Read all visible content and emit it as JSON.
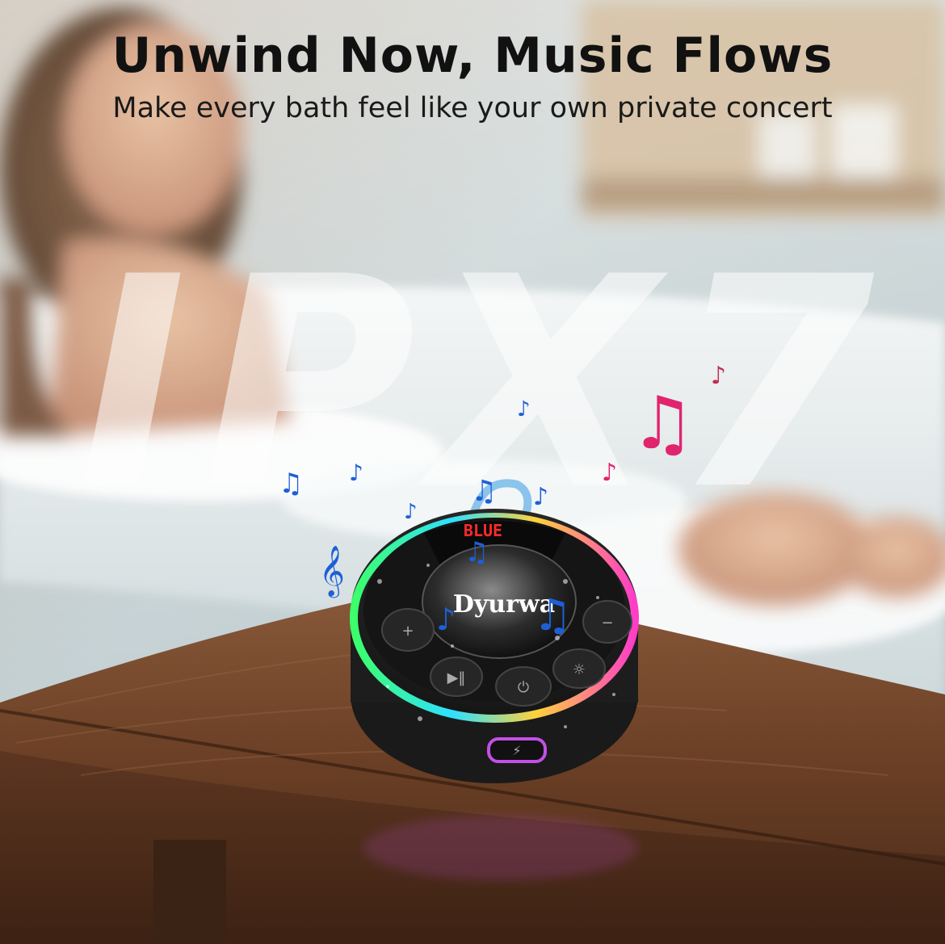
{
  "headline": "Unwind Now, Music Flows",
  "subline": "Make every bath feel like your own private concert",
  "rating_badge": "IPX7",
  "speaker": {
    "brand": "Dyurwa",
    "display_text": "BLUE"
  },
  "colors": {
    "headline": "#111111",
    "note_blue": "#1e5fd8",
    "note_pink": "#e0246e",
    "display_red": "#ff2a2a",
    "wood": "#5a3520"
  }
}
